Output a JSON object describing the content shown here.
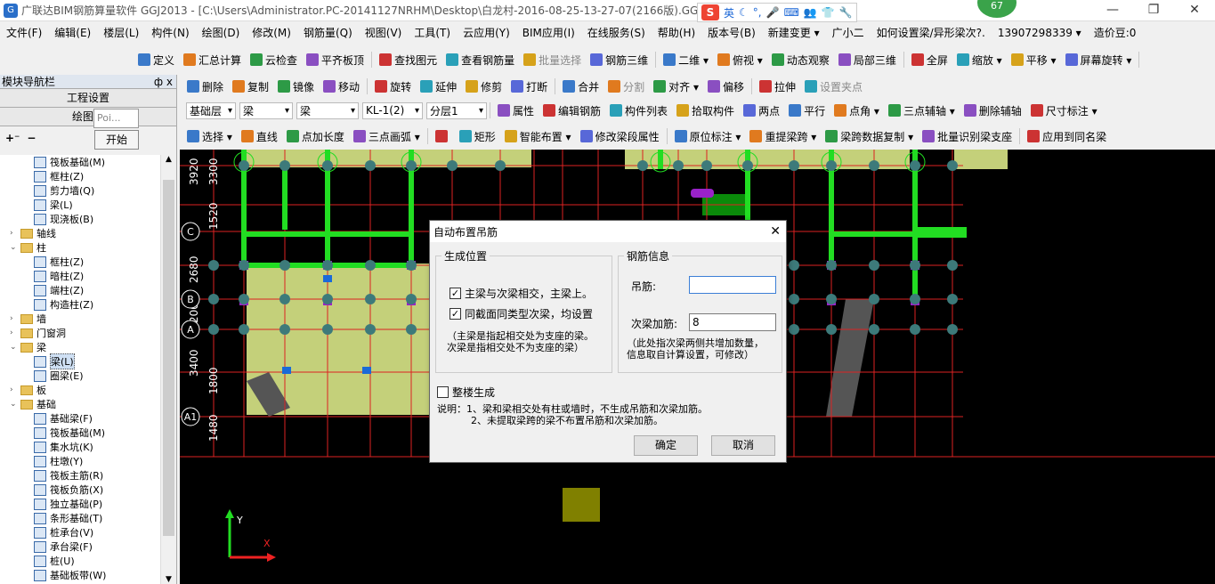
{
  "titlebar": {
    "title": "广联达BIM钢筋算量软件 GGJ2013 - [C:\\Users\\Administrator.PC-20141127NRHM\\Desktop\\白龙村-2016-08-25-13-27-07(2166版).GGJ1",
    "ime_lang": "英",
    "badge": "67",
    "minimize": "—",
    "restore": "❐",
    "close": "✕"
  },
  "menu": [
    "文件(F)",
    "编辑(E)",
    "楼层(L)",
    "构件(N)",
    "绘图(D)",
    "修改(M)",
    "钢筋量(Q)",
    "视图(V)",
    "工具(T)",
    "云应用(Y)",
    "BIM应用(I)",
    "在线服务(S)",
    "帮助(H)",
    "版本号(B)",
    "新建变更 ▾",
    "广小二",
    "如何设置梁/异形梁次?.",
    "13907298339 ▾",
    "造价豆:0"
  ],
  "toolbar1": [
    "定义",
    "汇总计算",
    "云检查",
    "平齐板顶",
    "查找图元",
    "查看钢筋量",
    "批量选择",
    "钢筋三维",
    "二维 ▾",
    "俯视 ▾",
    "动态观察",
    "局部三维",
    "全屏",
    "缩放 ▾",
    "平移 ▾",
    "屏幕旋转 ▾"
  ],
  "toolbar2": [
    "删除",
    "复制",
    "镜像",
    "移动",
    "旋转",
    "延伸",
    "修剪",
    "打断",
    "合并",
    "分割",
    "对齐 ▾",
    "偏移",
    "拉伸",
    "设置夹点"
  ],
  "toolbar3": {
    "floor": "基础层",
    "type1": "梁",
    "type2": "梁",
    "item": "KL-1(2)",
    "layer": "分层1",
    "buttons": [
      "属性",
      "编辑钢筋",
      "构件列表",
      "拾取构件",
      "两点",
      "平行",
      "点角 ▾",
      "三点辅轴 ▾",
      "删除辅轴",
      "尺寸标注 ▾"
    ]
  },
  "toolbar4": [
    "选择 ▾",
    "直线",
    "点加长度",
    "三点画弧 ▾",
    "",
    "矩形",
    "智能布置 ▾",
    "修改梁段属性",
    "原位标注 ▾",
    "重提梁跨 ▾",
    "梁跨数据复制 ▾",
    "批量识别梁支座",
    "应用到同名梁"
  ],
  "nav": {
    "title": "模块导航栏",
    "pin": "ф x",
    "btn_project": "工程设置",
    "btn_draw": "绘图输",
    "popup_text": "Poi...",
    "start_btn": "开始",
    "tree": [
      {
        "label": "筏板基础(M)",
        "level": 2,
        "kind": "item"
      },
      {
        "label": "框柱(Z)",
        "level": 2,
        "kind": "item"
      },
      {
        "label": "剪力墙(Q)",
        "level": 2,
        "kind": "item"
      },
      {
        "label": "梁(L)",
        "level": 2,
        "kind": "item"
      },
      {
        "label": "现浇板(B)",
        "level": 2,
        "kind": "item"
      },
      {
        "label": "轴线",
        "level": 1,
        "kind": "folder",
        "exp": "+"
      },
      {
        "label": "柱",
        "level": 1,
        "kind": "folder",
        "exp": "−"
      },
      {
        "label": "框柱(Z)",
        "level": 2,
        "kind": "item"
      },
      {
        "label": "暗柱(Z)",
        "level": 2,
        "kind": "item"
      },
      {
        "label": "端柱(Z)",
        "level": 2,
        "kind": "item"
      },
      {
        "label": "构造柱(Z)",
        "level": 2,
        "kind": "item"
      },
      {
        "label": "墙",
        "level": 1,
        "kind": "folder",
        "exp": "+"
      },
      {
        "label": "门窗洞",
        "level": 1,
        "kind": "folder",
        "exp": "+"
      },
      {
        "label": "梁",
        "level": 1,
        "kind": "folder",
        "exp": "−"
      },
      {
        "label": "梁(L)",
        "level": 2,
        "kind": "item",
        "sel": true
      },
      {
        "label": "圈梁(E)",
        "level": 2,
        "kind": "item"
      },
      {
        "label": "板",
        "level": 1,
        "kind": "folder",
        "exp": "+"
      },
      {
        "label": "基础",
        "level": 1,
        "kind": "folder",
        "exp": "−"
      },
      {
        "label": "基础梁(F)",
        "level": 2,
        "kind": "item"
      },
      {
        "label": "筏板基础(M)",
        "level": 2,
        "kind": "item"
      },
      {
        "label": "集水坑(K)",
        "level": 2,
        "kind": "item"
      },
      {
        "label": "柱墩(Y)",
        "level": 2,
        "kind": "item"
      },
      {
        "label": "筏板主筋(R)",
        "level": 2,
        "kind": "item"
      },
      {
        "label": "筏板负筋(X)",
        "level": 2,
        "kind": "item"
      },
      {
        "label": "独立基础(P)",
        "level": 2,
        "kind": "item"
      },
      {
        "label": "条形基础(T)",
        "level": 2,
        "kind": "item"
      },
      {
        "label": "桩承台(V)",
        "level": 2,
        "kind": "item"
      },
      {
        "label": "承台梁(F)",
        "level": 2,
        "kind": "item"
      },
      {
        "label": "桩(U)",
        "level": 2,
        "kind": "item"
      },
      {
        "label": "基础板带(W)",
        "level": 2,
        "kind": "item"
      }
    ]
  },
  "canvas": {
    "dims": [
      "3920",
      "3300",
      "1520",
      "2680",
      "2000",
      "3400",
      "1800",
      "1480"
    ],
    "axes": [
      "C",
      "B",
      "A",
      "A1"
    ],
    "axis_x": "X",
    "axis_y": "Y"
  },
  "dialog": {
    "title": "自动布置吊筋",
    "close": "✕",
    "group_pos": "生成位置",
    "cb1": "主梁与次梁相交，主梁上。",
    "cb2": "同截面同类型次梁，均设置",
    "note1a": "（主梁是指起相交处为支座的梁。",
    "note1b": "次梁是指相交处不为支座的梁）",
    "group_rebar": "钢筋信息",
    "label_hanger": "吊筋:",
    "value_hanger": "",
    "label_extra": "次梁加筋:",
    "value_extra": "8",
    "note2a": "（此处指次梁两侧共增加数量，",
    "note2b": "信息取自计算设置，可修改）",
    "cb3": "整楼生成",
    "desc1": "说明：1、梁和梁相交处有柱或墙时，不生成吊筋和次梁加筋。",
    "desc2": "2、未提取梁跨的梁不布置吊筋和次梁加筋。",
    "ok": "确定",
    "cancel": "取消"
  },
  "colors": {
    "beam": "#22dd22",
    "slab": "#c4d07a",
    "column": "#3d7a7a",
    "grid": "#dd2222"
  }
}
